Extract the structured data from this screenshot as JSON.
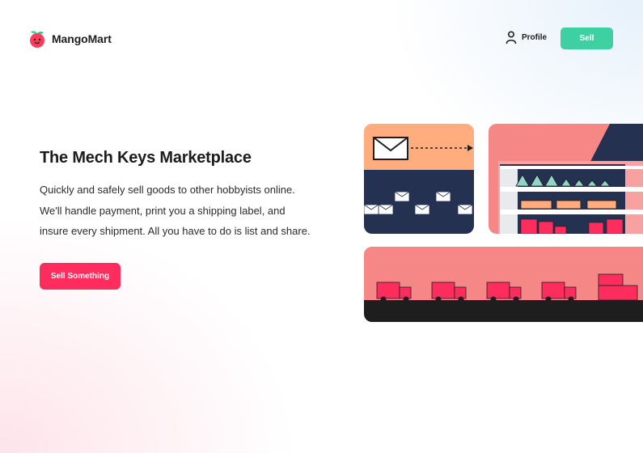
{
  "brand": {
    "name": "MangoMart",
    "logo_icon": "mango-icon"
  },
  "nav": {
    "profile_label": "Profile",
    "profile_icon": "user-icon",
    "sell_label": "Sell"
  },
  "hero": {
    "title": "The Mech Keys Marketplace",
    "body_lines": [
      "Quickly and safely sell goods to other hobbyists online.",
      "We'll handle payment, print you a shipping label, and",
      "insure every shipment. All you have to do is list and share."
    ],
    "cta_label": "Sell Something"
  },
  "colors": {
    "accent_pink": "#ff2d5e",
    "accent_green": "#3fd0a2",
    "salmon": "#f58787",
    "peach": "#ffac7e",
    "navy": "#243150",
    "ink": "#1f1f1f"
  },
  "illustrations": [
    "mail-panel",
    "warehouse-panel",
    "delivery-panel"
  ]
}
